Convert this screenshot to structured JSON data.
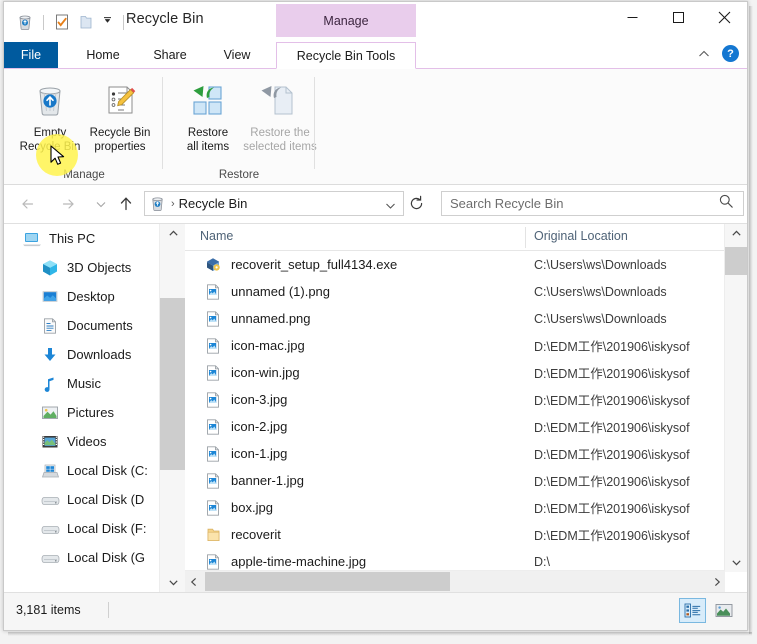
{
  "window": {
    "title": "Recycle Bin",
    "quick_access": [
      "recycle-bin-icon",
      "properties-icon",
      "folder-icon",
      "customize-dropdown"
    ],
    "buttons": {
      "minimize": "minimize",
      "maximize": "maximize",
      "close": "close"
    }
  },
  "ribbon": {
    "contextual_header": "Manage",
    "tabs": [
      {
        "label": "File",
        "active": false
      },
      {
        "label": "Home",
        "active": false
      },
      {
        "label": "Share",
        "active": false
      },
      {
        "label": "View",
        "active": false
      },
      {
        "label": "Recycle Bin Tools",
        "active": true
      }
    ],
    "collapse_icon": "chevron-up-icon",
    "help_label": "?",
    "groups": [
      {
        "name": "Manage",
        "buttons": [
          {
            "label_line1": "Empty",
            "label_line2": "Recycle Bin",
            "icon": "empty-recycle-bin-icon",
            "disabled": false
          },
          {
            "label_line1": "Recycle Bin",
            "label_line2": "properties",
            "icon": "recycle-bin-properties-icon",
            "disabled": false
          }
        ]
      },
      {
        "name": "Restore",
        "buttons": [
          {
            "label_line1": "Restore",
            "label_line2": "all items",
            "icon": "restore-all-icon",
            "disabled": false
          },
          {
            "label_line1": "Restore the",
            "label_line2": "selected items",
            "icon": "restore-selected-icon",
            "disabled": true
          }
        ]
      }
    ]
  },
  "addressbar": {
    "back": "back-arrow",
    "forward": "forward-arrow",
    "recent": "recent-locations-dropdown",
    "up": "up-arrow",
    "crumb_icon": "recycle-bin-icon",
    "crumb": "Recycle Bin",
    "dropdown": "chevron-down-icon",
    "refresh": "refresh-icon",
    "search_placeholder": "Search Recycle Bin",
    "search_value": ""
  },
  "navpane": {
    "items": [
      {
        "label": "This PC",
        "icon": "this-pc-icon",
        "root": true
      },
      {
        "label": "3D Objects",
        "icon": "3d-objects-icon",
        "root": false
      },
      {
        "label": "Desktop",
        "icon": "desktop-icon",
        "root": false
      },
      {
        "label": "Documents",
        "icon": "documents-icon",
        "root": false
      },
      {
        "label": "Downloads",
        "icon": "downloads-icon",
        "root": false
      },
      {
        "label": "Music",
        "icon": "music-icon",
        "root": false
      },
      {
        "label": "Pictures",
        "icon": "pictures-icon",
        "root": false
      },
      {
        "label": "Videos",
        "icon": "videos-icon",
        "root": false
      },
      {
        "label": "Local Disk (C:",
        "icon": "windows-drive-icon",
        "root": false
      },
      {
        "label": "Local Disk (D",
        "icon": "drive-icon",
        "root": false
      },
      {
        "label": "Local Disk (F:",
        "icon": "drive-icon",
        "root": false
      },
      {
        "label": "Local Disk (G",
        "icon": "drive-icon",
        "root": false
      }
    ]
  },
  "filelist": {
    "columns": [
      "Name",
      "Original Location"
    ],
    "rows": [
      {
        "name": "recoverit_setup_full4134.exe",
        "location": "C:\\Users\\ws\\Downloads",
        "icon": "exe-icon"
      },
      {
        "name": "unnamed (1).png",
        "location": "C:\\Users\\ws\\Downloads",
        "icon": "image-icon"
      },
      {
        "name": "unnamed.png",
        "location": "C:\\Users\\ws\\Downloads",
        "icon": "image-icon"
      },
      {
        "name": "icon-mac.jpg",
        "location": "D:\\EDM工作\\201906\\iskysof",
        "icon": "image-icon"
      },
      {
        "name": "icon-win.jpg",
        "location": "D:\\EDM工作\\201906\\iskysof",
        "icon": "image-icon"
      },
      {
        "name": "icon-3.jpg",
        "location": "D:\\EDM工作\\201906\\iskysof",
        "icon": "image-icon"
      },
      {
        "name": "icon-2.jpg",
        "location": "D:\\EDM工作\\201906\\iskysof",
        "icon": "image-icon"
      },
      {
        "name": "icon-1.jpg",
        "location": "D:\\EDM工作\\201906\\iskysof",
        "icon": "image-icon"
      },
      {
        "name": "banner-1.jpg",
        "location": "D:\\EDM工作\\201906\\iskysof",
        "icon": "image-icon"
      },
      {
        "name": "box.jpg",
        "location": "D:\\EDM工作\\201906\\iskysof",
        "icon": "image-icon"
      },
      {
        "name": "recoverit",
        "location": "D:\\EDM工作\\201906\\iskysof",
        "icon": "folder-icon"
      },
      {
        "name": "apple-time-machine.jpg",
        "location": "D:\\",
        "icon": "image-icon"
      }
    ]
  },
  "statusbar": {
    "item_count": "3,181 items",
    "views": [
      {
        "name": "details-view",
        "selected": true
      },
      {
        "name": "large-icons-view",
        "selected": false
      }
    ]
  }
}
